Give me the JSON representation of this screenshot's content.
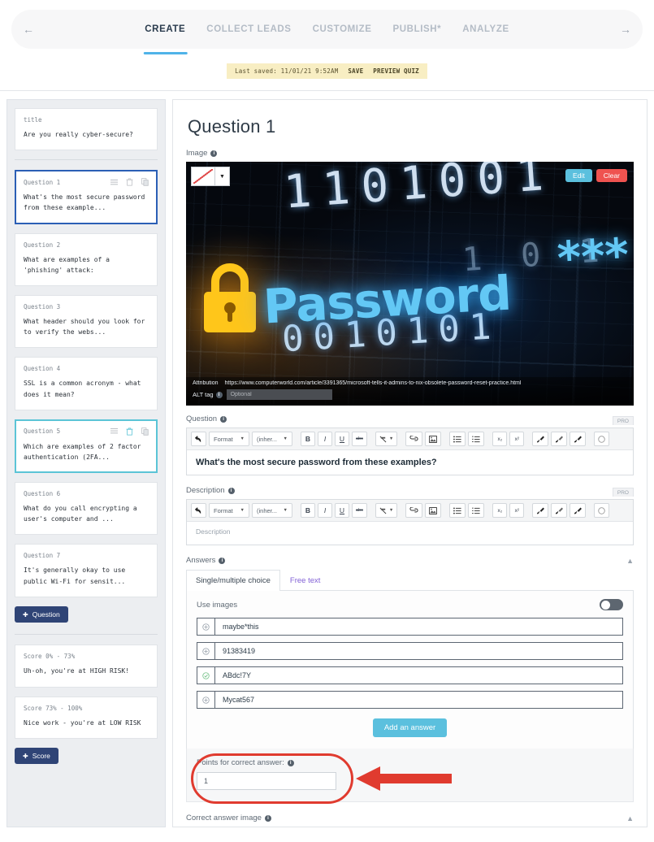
{
  "topnav": {
    "back_icon": "arrow-left-icon",
    "forward_icon": "arrow-right-icon",
    "tabs": [
      {
        "label": "CREATE",
        "active": true
      },
      {
        "label": "COLLECT LEADS",
        "active": false
      },
      {
        "label": "CUSTOMIZE",
        "active": false
      },
      {
        "label": "PUBLISH*",
        "active": false
      },
      {
        "label": "ANALYZE",
        "active": false
      }
    ]
  },
  "savebar": {
    "saved_text": "Last saved: 11/01/21 9:52AM",
    "save_label": "SAVE",
    "preview_label": "PREVIEW QUIZ"
  },
  "sidebar": {
    "title_card": {
      "meta": "title",
      "body": "Are you really cyber-secure?"
    },
    "questions": [
      {
        "meta": "Question 1",
        "body": "What's the most secure password from these example...",
        "selected": "blue"
      },
      {
        "meta": "Question 2",
        "body": "What are examples of a 'phishing' attack:",
        "selected": "none"
      },
      {
        "meta": "Question 3",
        "body": "What header should you look for to verify the webs...",
        "selected": "none"
      },
      {
        "meta": "Question 4",
        "body": "SSL is a common acronym - what does it mean?",
        "selected": "none"
      },
      {
        "meta": "Question 5",
        "body": "Which are examples of 2 factor authentication (2FA...",
        "selected": "cyan"
      },
      {
        "meta": "Question 6",
        "body": "What do you call encrypting a user's computer and ...",
        "selected": "none"
      },
      {
        "meta": "Question 7",
        "body": "It's generally okay to use public Wi-Fi for sensit...",
        "selected": "none"
      }
    ],
    "add_question_label": "Question",
    "scores": [
      {
        "meta": "Score 0% - 73%",
        "body": "Uh-oh, you're at HIGH RISK!"
      },
      {
        "meta": "Score 73% - 100%",
        "body": "Nice work - you're at LOW RISK"
      }
    ],
    "add_score_label": "Score"
  },
  "main": {
    "page_title": "Question 1",
    "image_section": {
      "label": "Image",
      "edit_label": "Edit",
      "clear_label": "Clear",
      "attribution_label": "Attribution",
      "attribution_url": "https://www.computerworld.com/article/3391365/microsoft-tells-it-admins-to-nix-obsolete-password-reset-practice.html",
      "alt_label": "ALT tag",
      "alt_placeholder": "Optional",
      "alt_value": "",
      "artwork": {
        "word": "Password",
        "stars": "***",
        "binary_top": "1101001",
        "binary_mid": "1 0 1",
        "binary_bottom": "0010101",
        "lock_color": "#ffc61a",
        "text_color": "#63c8f5"
      }
    },
    "question_section": {
      "label": "Question",
      "pro_badge": "PRO",
      "value": "What's the most secure password from these examples?",
      "toolbar": [
        {
          "name": "undo-icon",
          "label": "⮌"
        },
        {
          "name": "format-select",
          "label": "Format"
        },
        {
          "name": "font-select",
          "label": "(inher..."
        },
        {
          "name": "bold-icon",
          "label": "B"
        },
        {
          "name": "italic-icon",
          "label": "I"
        },
        {
          "name": "underline-icon",
          "label": "U"
        },
        {
          "name": "strikethrough-icon",
          "label": "abc"
        },
        {
          "name": "clear-format-icon",
          "label": "✒"
        },
        {
          "name": "link-icon",
          "label": "↭"
        },
        {
          "name": "image-icon",
          "label": "Ὓc"
        },
        {
          "name": "bullet-list-icon",
          "label": "≡"
        },
        {
          "name": "numbered-list-icon",
          "label": "≣"
        },
        {
          "name": "subscript-icon",
          "label": "x₂"
        },
        {
          "name": "superscript-icon",
          "label": "x²"
        },
        {
          "name": "text-color-icon",
          "label": "✐"
        },
        {
          "name": "highlight-icon",
          "label": "✐"
        },
        {
          "name": "background-color-icon",
          "label": "✐"
        },
        {
          "name": "emoji-icon",
          "label": "○"
        }
      ]
    },
    "description_section": {
      "label": "Description",
      "pro_badge": "PRO",
      "placeholder": "Description",
      "value": ""
    },
    "answers_section": {
      "label": "Answers",
      "tabs": [
        {
          "label": "Single/multiple choice",
          "active": true
        },
        {
          "label": "Free text",
          "active": false
        }
      ],
      "use_images_label": "Use images",
      "use_images_on": false,
      "answers": [
        {
          "text": "maybe*this",
          "correct": false
        },
        {
          "text": "91383419",
          "correct": false
        },
        {
          "text": "ABdc!7Y",
          "correct": true
        },
        {
          "text": "Mycat567",
          "correct": false
        }
      ],
      "add_answer_label": "Add an answer"
    },
    "points_section": {
      "label": "Points for correct answer:",
      "value": "1",
      "highlight_color": "#e03b2f"
    },
    "correct_answer_image_label": "Correct answer image"
  },
  "colors": {
    "accent_blue": "#4fb3e8",
    "button_blue": "#5bc0de",
    "danger_red": "#ef5350",
    "dark_navy": "#2f4476",
    "annotation_red": "#e03b2f",
    "purple_link": "#8261d6",
    "correct_green": "#76c28a"
  }
}
